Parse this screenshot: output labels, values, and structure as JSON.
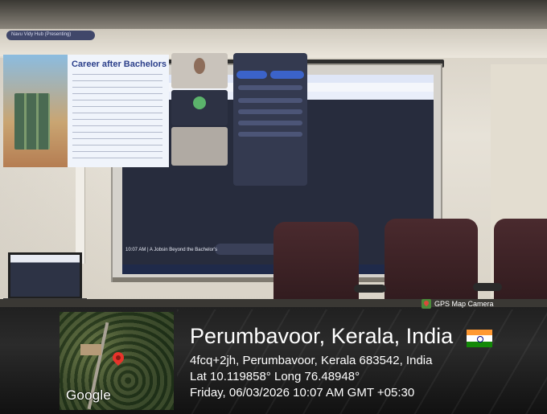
{
  "overlay": {
    "badge_label": "GPS Map Camera",
    "map_logo": "Google",
    "location_title": "Perumbavoor, Kerala, India",
    "address": "4fcq+2jh, Perumbavoor, Kerala 683542, India",
    "coordinates": "Lat 10.119858° Long 76.48948°",
    "datetime": "Friday, 06/03/2026 10:07 AM GMT +05:30",
    "flag_icon": "india-flag-icon",
    "pin_icon": "map-pin-icon"
  },
  "projection": {
    "slide_title": "Career after Bachelors",
    "meeting_title": "Navu Vidy Hub (Presenting)",
    "caption": "10:07 AM | A Jobsin Beyond the Bachelor's"
  },
  "colors": {
    "chair": "#3d2226",
    "table": "#1e1e1e",
    "pin": "#e8342b",
    "overlay_text": "#ffffff"
  }
}
